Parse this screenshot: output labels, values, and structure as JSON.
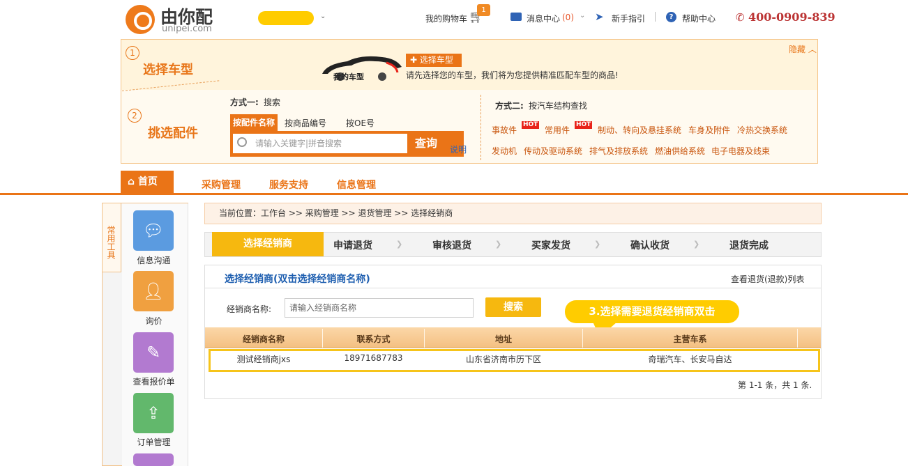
{
  "header": {
    "logo_text": "由你配",
    "logo_sub": "unipei.com",
    "cart_label": "我的购物车",
    "cart_badge": "1",
    "msg_label": "消息中心",
    "msg_count": "(0)",
    "guide_label": "新手指引",
    "help_label": "帮助中心",
    "phone": "400-0909-839"
  },
  "picker": {
    "step1_num": "1",
    "step1_title": "选择车型",
    "car_badge": "我的车型",
    "choose_car": "选择车型",
    "car_hint": "请先选择您的车型，我们将为您提供精准匹配车型的商品!",
    "hide": "隐藏",
    "step2_num": "2",
    "step2_title": "挑选配件",
    "m1_label": "方式一:",
    "m1_text": "搜索",
    "tabs": [
      "按配件名称",
      "按商品编号",
      "按OE号"
    ],
    "search_placeholder": "请输入关键字|拼音搜索",
    "query": "查询",
    "explain": "说明",
    "m2_label": "方式二:",
    "m2_text": "按汽车结构查找",
    "hot": "HOT",
    "cats_row1": [
      "事故件",
      "常用件",
      "制动、转向及悬挂系统",
      "车身及附件",
      "冷热交换系统"
    ],
    "cats_row2": [
      "发动机",
      "传动及驱动系统",
      "排气及排放系统",
      "燃油供给系统",
      "电子电器及线束"
    ]
  },
  "nav": {
    "home": "首页",
    "items": [
      "采购管理",
      "服务支持",
      "信息管理"
    ]
  },
  "sidebar": {
    "tab": "常用工具",
    "tools": [
      "信息沟通",
      "询价",
      "查看报价单",
      "订单管理"
    ]
  },
  "breadcrumb": "当前位置：工作台 >> 采购管理 >> 退货管理 >> 选择经销商",
  "steps": [
    "选择经销商",
    "申请退货",
    "审核退货",
    "买家发货",
    "确认收货",
    "退货完成"
  ],
  "panel": {
    "title": "选择经销商(双击选择经销商名称)",
    "link": "查看退货(退款)列表",
    "dealer_label": "经销商名称:",
    "dealer_placeholder": "请输入经销商名称",
    "search": "搜索",
    "tip": "3.选择需要退货经销商双击",
    "columns": [
      "经销商名称",
      "联系方式",
      "地址",
      "主营车系"
    ],
    "rows": [
      {
        "name": "测试经销商jxs",
        "phone": "18971687783",
        "address": "山东省济南市历下区",
        "series": "奇瑞汽车、长安马自达"
      }
    ],
    "pager": "第 1-1 条，共 1 条."
  },
  "colors": {
    "accent": "#ea7417",
    "yellow": "#f6b80f",
    "link": "#1f5fb0"
  }
}
